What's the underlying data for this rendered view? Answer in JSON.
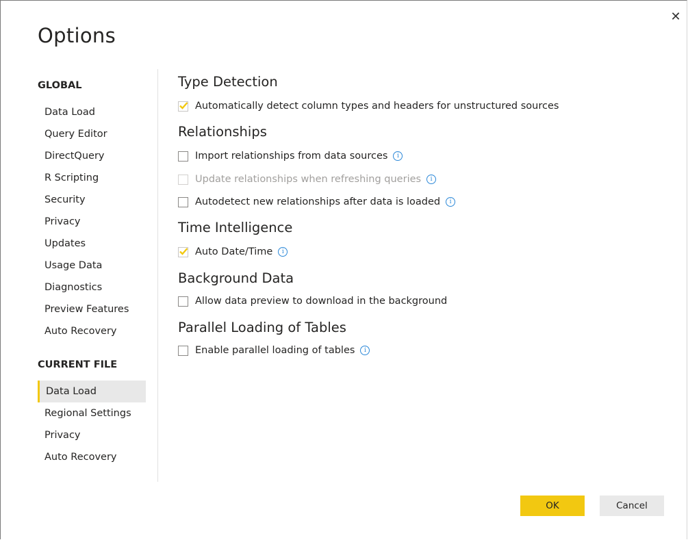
{
  "dialog": {
    "title": "Options",
    "close_glyph": "✕",
    "accent_color": "#f2c811"
  },
  "sidebar": {
    "global_heading": "GLOBAL",
    "global_items": [
      {
        "label": "Data Load"
      },
      {
        "label": "Query Editor"
      },
      {
        "label": "DirectQuery"
      },
      {
        "label": "R Scripting"
      },
      {
        "label": "Security"
      },
      {
        "label": "Privacy"
      },
      {
        "label": "Updates"
      },
      {
        "label": "Usage Data"
      },
      {
        "label": "Diagnostics"
      },
      {
        "label": "Preview Features"
      },
      {
        "label": "Auto Recovery"
      }
    ],
    "current_heading": "CURRENT FILE",
    "current_items": [
      {
        "label": "Data Load",
        "selected": true
      },
      {
        "label": "Regional Settings"
      },
      {
        "label": "Privacy"
      },
      {
        "label": "Auto Recovery"
      }
    ]
  },
  "content": {
    "type_detection": {
      "title": "Type Detection",
      "opt1": {
        "label": "Automatically detect column types and headers for unstructured sources",
        "checked": true
      }
    },
    "relationships": {
      "title": "Relationships",
      "opt1": {
        "label": "Import relationships from data sources",
        "checked": false,
        "info": "i"
      },
      "opt2": {
        "label": "Update relationships when refreshing queries",
        "checked": false,
        "disabled": true,
        "info": "i"
      },
      "opt3": {
        "label": "Autodetect new relationships after data is loaded",
        "checked": false,
        "info": "i"
      }
    },
    "time_intelligence": {
      "title": "Time Intelligence",
      "opt1": {
        "label": "Auto Date/Time",
        "checked": true,
        "info": "i"
      }
    },
    "background_data": {
      "title": "Background Data",
      "opt1": {
        "label": "Allow data preview to download in the background",
        "checked": false
      }
    },
    "parallel_loading": {
      "title": "Parallel Loading of Tables",
      "opt1": {
        "label": "Enable parallel loading of tables",
        "checked": false,
        "info": "i"
      }
    }
  },
  "footer": {
    "ok_label": "OK",
    "cancel_label": "Cancel"
  }
}
